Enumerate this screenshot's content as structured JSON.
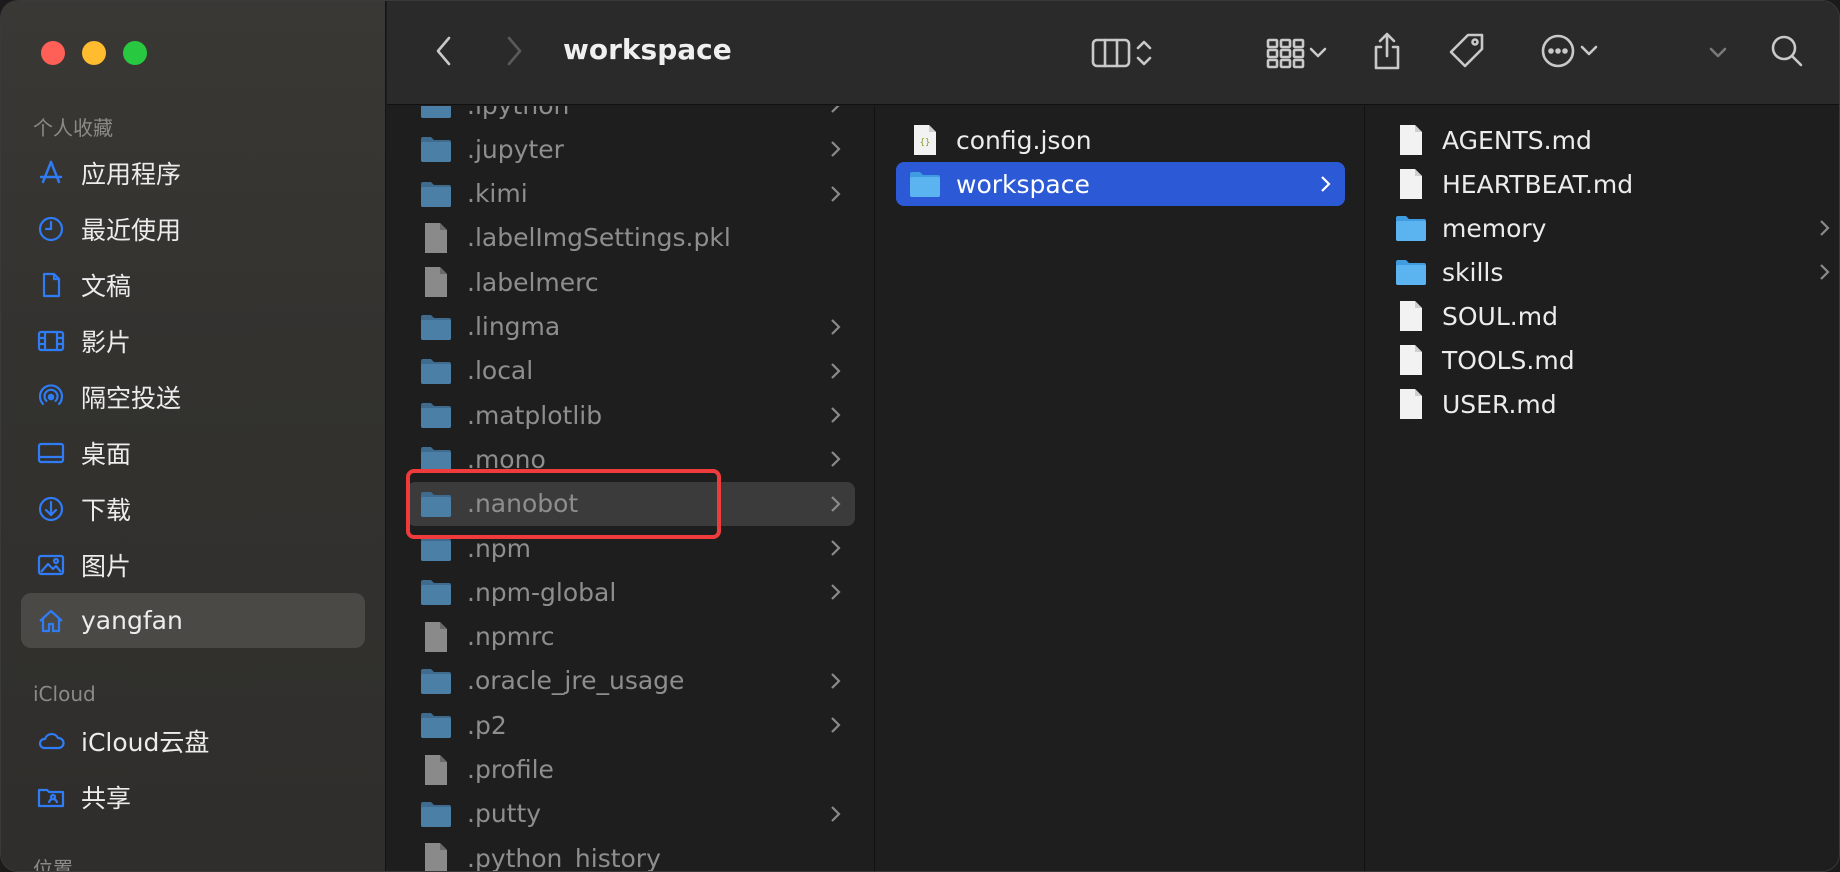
{
  "window": {
    "title": "workspace"
  },
  "sidebar": {
    "favorites_title": "个人收藏",
    "favorites": [
      {
        "label": "应用程序",
        "icon": "applications-icon"
      },
      {
        "label": "最近使用",
        "icon": "clock-icon"
      },
      {
        "label": "文稿",
        "icon": "document-icon"
      },
      {
        "label": "影片",
        "icon": "film-icon"
      },
      {
        "label": "隔空投送",
        "icon": "airdrop-icon"
      },
      {
        "label": "桌面",
        "icon": "desktop-icon"
      },
      {
        "label": "下载",
        "icon": "download-icon"
      },
      {
        "label": "图片",
        "icon": "photo-icon"
      },
      {
        "label": "yangfan",
        "icon": "home-icon"
      }
    ],
    "icloud_title": "iCloud",
    "icloud": [
      {
        "label": "iCloud云盘",
        "icon": "cloud-icon"
      },
      {
        "label": "共享",
        "icon": "shared-folder-icon"
      }
    ],
    "locations_title": "位置",
    "active_item": "yangfan",
    "accent_color": "#2f7cf6"
  },
  "columns": {
    "col1": [
      {
        "name": ".ipython",
        "type": "folder"
      },
      {
        "name": ".jupyter",
        "type": "folder"
      },
      {
        "name": ".kimi",
        "type": "folder"
      },
      {
        "name": ".labelImgSettings.pkl",
        "type": "file"
      },
      {
        "name": ".labelmerc",
        "type": "file"
      },
      {
        "name": ".lingma",
        "type": "folder"
      },
      {
        "name": ".local",
        "type": "folder"
      },
      {
        "name": ".matplotlib",
        "type": "folder"
      },
      {
        "name": ".mono",
        "type": "folder"
      },
      {
        "name": ".nanobot",
        "type": "folder"
      },
      {
        "name": ".npm",
        "type": "folder"
      },
      {
        "name": ".npm-global",
        "type": "folder"
      },
      {
        "name": ".npmrc",
        "type": "file"
      },
      {
        "name": ".oracle_jre_usage",
        "type": "folder"
      },
      {
        "name": ".p2",
        "type": "folder"
      },
      {
        "name": ".profile",
        "type": "file"
      },
      {
        "name": ".putty",
        "type": "folder"
      },
      {
        "name": ".python_history",
        "type": "file"
      }
    ],
    "col1_highlighted": ".nanobot",
    "col2": [
      {
        "name": "config.json",
        "type": "json"
      },
      {
        "name": "workspace",
        "type": "folder"
      }
    ],
    "col2_selected": "workspace",
    "col3": [
      {
        "name": "AGENTS.md",
        "type": "file"
      },
      {
        "name": "HEARTBEAT.md",
        "type": "file"
      },
      {
        "name": "memory",
        "type": "folder"
      },
      {
        "name": "skills",
        "type": "folder"
      },
      {
        "name": "SOUL.md",
        "type": "file"
      },
      {
        "name": "TOOLS.md",
        "type": "file"
      },
      {
        "name": "USER.md",
        "type": "file"
      }
    ]
  },
  "colors": {
    "selection": "#2c5ad6",
    "highlight_box": "#ef3b3b",
    "folder_blue": "#5bb4f0"
  }
}
